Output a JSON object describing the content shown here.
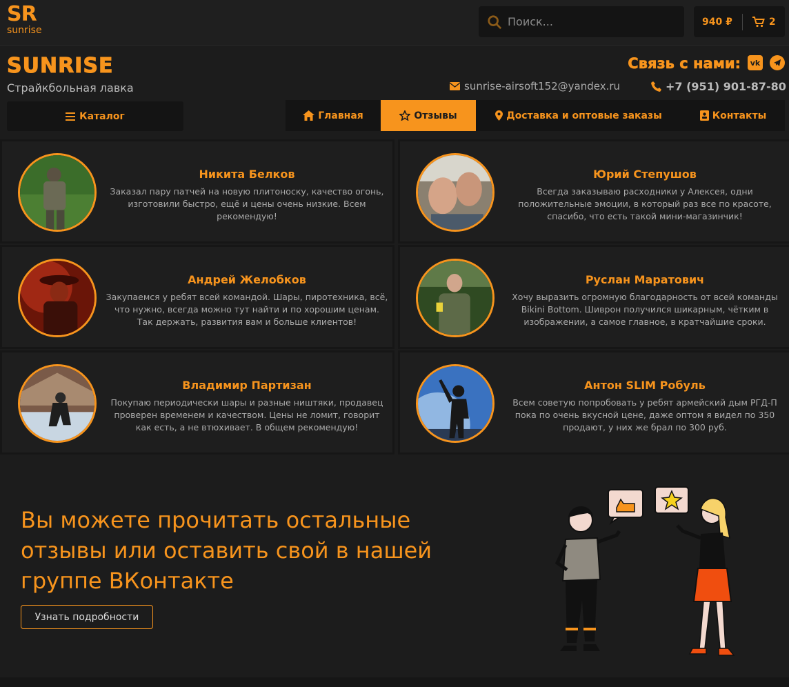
{
  "topbar": {
    "logo_main": "SR",
    "logo_sub": "sunrise",
    "search_placeholder": "Поиск...",
    "cart_total": "940 ₽",
    "cart_count": "2"
  },
  "header": {
    "brand": "SUNRISE",
    "tagline": "Страйкбольная лавка",
    "contact_title": "Связь с нами:",
    "social": [
      "vk-icon",
      "telegram-icon"
    ],
    "email": "sunrise-airsoft152@yandex.ru",
    "phone": "+7 (951) 901-87-80"
  },
  "nav": {
    "catalog": "Каталог",
    "items": [
      {
        "label": "Главная",
        "icon": "home-icon"
      },
      {
        "label": "Отзывы",
        "icon": "star-icon",
        "active": true
      },
      {
        "label": "Доставка и оптовые заказы",
        "icon": "map-marker-icon"
      },
      {
        "label": "Контакты",
        "icon": "contact-card-icon"
      }
    ]
  },
  "reviews": [
    {
      "name": "Никита Белков",
      "text": "Заказал пару патчей на новую плитоноску, качество огонь, изготовили быстро, ещё и цены очень низкие. Всем рекомендую!"
    },
    {
      "name": "Юрий Степушов",
      "text": "Всегда заказываю расходники у Алексея, одни положительные эмоции, в который раз все по красоте, спасибо, что есть такой мини-магазинчик!"
    },
    {
      "name": "Андрей Желобков",
      "text": "Закупаемся у ребят всей командой. Шары, пиротехника, всё, что нужно, всегда можно тут найти и по хорошим ценам. Так держать, развития вам и больше клиентов!"
    },
    {
      "name": "Руслан Маратович",
      "text": "Хочу выразить огромную благодарность от всей команды Bikini Bottom. Шиврон получился шикарным, чётким в изображении, а самое главное, в кратчайшие сроки."
    },
    {
      "name": "Владимир Партизан",
      "text": "Покупаю периодически шары и разные ништяки, продавец проверен временем и качеством. Цены не ломит, говорит как есть, а не втюхивает. В общем рекомендую!"
    },
    {
      "name": "Антон SLIM Робуль",
      "text": "Всем советую попробовать у ребят армейский дым РГД-П пока по очень вкусной цене, даже оптом я видел по 350 продают, у них же брал по 300 руб."
    }
  ],
  "promo": {
    "title": "Вы можете прочитать остальные отзывы или оставить свой в нашей группе ВКонтакте",
    "button": "Узнать подробности"
  },
  "colors": {
    "accent": "#f7941d",
    "background": "#1c1c1c",
    "card": "#1e1e1e"
  }
}
